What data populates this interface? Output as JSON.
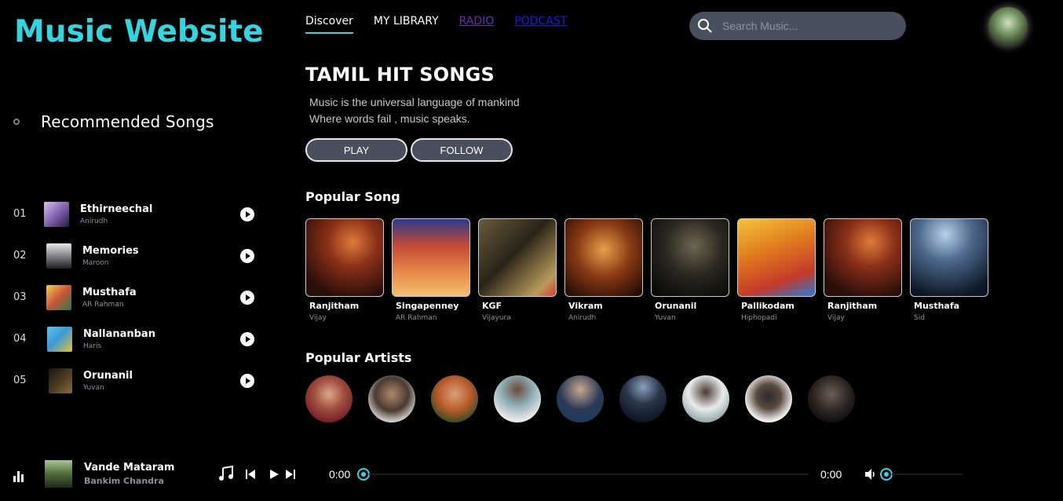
{
  "logo": "Music Website",
  "nav": {
    "items": [
      "Discover",
      "MY LIBRARY",
      "RADIO",
      "PODCAST"
    ]
  },
  "search": {
    "placeholder": "Search Music..."
  },
  "recommended": {
    "title": "Recommended Songs",
    "songs": [
      {
        "num": "01",
        "name": "Ethirneechal",
        "artist": "Anirudh",
        "color": "#7a5aa8"
      },
      {
        "num": "02",
        "name": "Memories",
        "artist": "Maroon",
        "color": "#3c3f46"
      },
      {
        "num": "03",
        "name": "Musthafa",
        "artist": "AR Rahman",
        "color": "#c8553a"
      },
      {
        "num": "04",
        "name": "Nallananban",
        "artist": "Haris",
        "color": "#3a9ad6"
      },
      {
        "num": "05",
        "name": "Orunanil",
        "artist": "Yuvan",
        "color": "#4a3a22"
      }
    ]
  },
  "hero": {
    "title": "TAMIL HIT SONGS",
    "line1": "Music is the universal language of mankind",
    "line2": "Where words fail , music speaks.",
    "play_label": "PLAY",
    "follow_label": "FOLLOW"
  },
  "popular_songs": {
    "title": "Popular Song",
    "items": [
      {
        "name": "Ranjitham",
        "artist": "Vijay",
        "c1": "#3a1410",
        "c2": "#b8602f"
      },
      {
        "name": "Singapenney",
        "artist": "AR Rahman",
        "c1": "#b53d2c",
        "c2": "#e28c4a"
      },
      {
        "name": "KGF",
        "artist": "Vijayura",
        "c1": "#2a2418",
        "c2": "#9c8354"
      },
      {
        "name": "Vikram",
        "artist": "Anirudh",
        "c1": "#5c2a12",
        "c2": "#d98a2e"
      },
      {
        "name": "Orunanil",
        "artist": "Yuvan",
        "c1": "#0e0e0c",
        "c2": "#4a4538"
      },
      {
        "name": "Pallikodam",
        "artist": "Hiphopadi",
        "c1": "#d47a1e",
        "c2": "#f0c23a"
      },
      {
        "name": "Ranjitham",
        "artist": "Vijay",
        "c1": "#3a1410",
        "c2": "#b8602f"
      },
      {
        "name": "Musthafa",
        "artist": "Sid",
        "c1": "#0c1a2c",
        "c2": "#6e8fb0"
      }
    ]
  },
  "popular_artists": {
    "title": "Popular Artists",
    "items": [
      {
        "name": "artist-1",
        "c1": "#7a1f2a",
        "c2": "#e0a98a"
      },
      {
        "name": "artist-2",
        "c1": "#1a1a1a",
        "c2": "#8a6a58"
      },
      {
        "name": "artist-3",
        "c1": "#2f4a1e",
        "c2": "#d9a079"
      },
      {
        "name": "artist-4",
        "c1": "#dadada",
        "c2": "#8fb0b8"
      },
      {
        "name": "artist-5",
        "c1": "#1d3a5c",
        "c2": "#c9a78d"
      },
      {
        "name": "artist-6",
        "c1": "#0d1624",
        "c2": "#5b7294"
      },
      {
        "name": "artist-7",
        "c1": "#8ea3a6",
        "c2": "#e0e6e6"
      },
      {
        "name": "artist-8",
        "c1": "#ededed",
        "c2": "#222"
      },
      {
        "name": "artist-9",
        "c1": "#0a0a0a",
        "c2": "#6d5d55"
      }
    ]
  },
  "player": {
    "title": "Vande Mataram",
    "artist": "Bankim Chandra",
    "current_time": "0:00",
    "duration": "0:00",
    "progress": 0,
    "volume": 0
  },
  "colors": {
    "accent": "#2fd7e0",
    "pill": "#4a4f5e"
  }
}
